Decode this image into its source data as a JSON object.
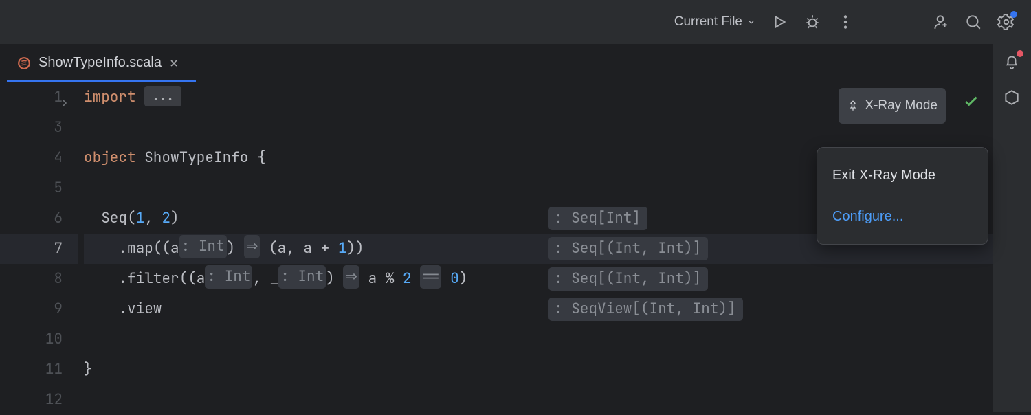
{
  "toolbar": {
    "run_config": "Current File"
  },
  "tab": {
    "filename": "ShowTypeInfo.scala"
  },
  "gutter": {
    "lines": [
      "1",
      "3",
      "4",
      "5",
      "6",
      "7",
      "8",
      "9",
      "10",
      "11",
      "12"
    ]
  },
  "code": {
    "line1": {
      "kw": "import",
      "fold": "..."
    },
    "line4": {
      "kw": "object",
      "rest": " ShowTypeInfo {"
    },
    "line6": {
      "indent": "  ",
      "pre": "Seq(",
      "n1": "1",
      "mid": ", ",
      "n2": "2",
      "post": ")",
      "type": ": Seq[Int]"
    },
    "line7": {
      "indent": "    ",
      "a": ".map((a",
      "h1": ": Int",
      "b": ") ",
      "h2": "⇒",
      "c": " (a, a + ",
      "n": "1",
      "d": "))",
      "type": ": Seq[(Int, Int)]"
    },
    "line8": {
      "indent": "    ",
      "a": ".filter((a",
      "h1": ": Int",
      "b": ", _",
      "h2": ": Int",
      "c": ") ",
      "h3": "⇒",
      "d": " a % ",
      "n1": "2",
      "e": " ",
      "h4": "==",
      "f": " ",
      "n2": "0",
      "g": ")",
      "type": ": Seq[(Int, Int)]"
    },
    "line9": {
      "indent": "    ",
      "a": ".view",
      "type": ": SeqView[(Int, Int)]"
    },
    "line11": "}"
  },
  "xray": {
    "label": "X-Ray Mode"
  },
  "popup": {
    "exit": "Exit X-Ray Mode",
    "configure": "Configure..."
  }
}
